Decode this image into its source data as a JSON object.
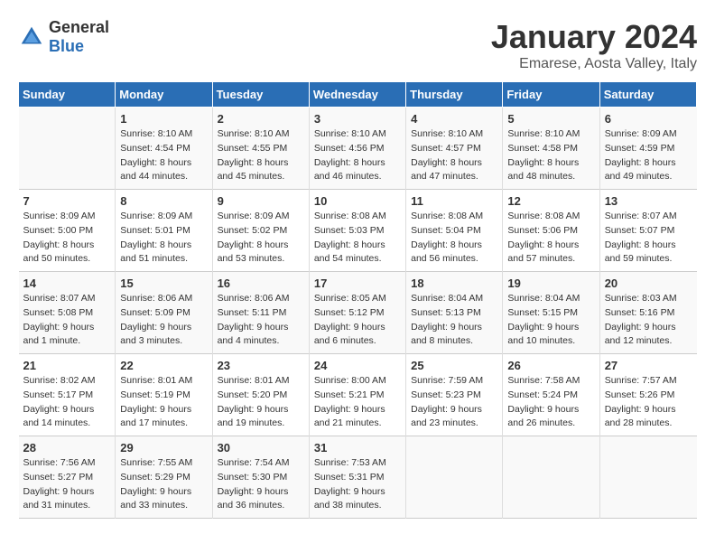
{
  "logo": {
    "general": "General",
    "blue": "Blue"
  },
  "header": {
    "month": "January 2024",
    "location": "Emarese, Aosta Valley, Italy"
  },
  "weekdays": [
    "Sunday",
    "Monday",
    "Tuesday",
    "Wednesday",
    "Thursday",
    "Friday",
    "Saturday"
  ],
  "weeks": [
    [
      {
        "day": "",
        "sunrise": "",
        "sunset": "",
        "daylight": ""
      },
      {
        "day": "1",
        "sunrise": "Sunrise: 8:10 AM",
        "sunset": "Sunset: 4:54 PM",
        "daylight": "Daylight: 8 hours and 44 minutes."
      },
      {
        "day": "2",
        "sunrise": "Sunrise: 8:10 AM",
        "sunset": "Sunset: 4:55 PM",
        "daylight": "Daylight: 8 hours and 45 minutes."
      },
      {
        "day": "3",
        "sunrise": "Sunrise: 8:10 AM",
        "sunset": "Sunset: 4:56 PM",
        "daylight": "Daylight: 8 hours and 46 minutes."
      },
      {
        "day": "4",
        "sunrise": "Sunrise: 8:10 AM",
        "sunset": "Sunset: 4:57 PM",
        "daylight": "Daylight: 8 hours and 47 minutes."
      },
      {
        "day": "5",
        "sunrise": "Sunrise: 8:10 AM",
        "sunset": "Sunset: 4:58 PM",
        "daylight": "Daylight: 8 hours and 48 minutes."
      },
      {
        "day": "6",
        "sunrise": "Sunrise: 8:09 AM",
        "sunset": "Sunset: 4:59 PM",
        "daylight": "Daylight: 8 hours and 49 minutes."
      }
    ],
    [
      {
        "day": "7",
        "sunrise": "Sunrise: 8:09 AM",
        "sunset": "Sunset: 5:00 PM",
        "daylight": "Daylight: 8 hours and 50 minutes."
      },
      {
        "day": "8",
        "sunrise": "Sunrise: 8:09 AM",
        "sunset": "Sunset: 5:01 PM",
        "daylight": "Daylight: 8 hours and 51 minutes."
      },
      {
        "day": "9",
        "sunrise": "Sunrise: 8:09 AM",
        "sunset": "Sunset: 5:02 PM",
        "daylight": "Daylight: 8 hours and 53 minutes."
      },
      {
        "day": "10",
        "sunrise": "Sunrise: 8:08 AM",
        "sunset": "Sunset: 5:03 PM",
        "daylight": "Daylight: 8 hours and 54 minutes."
      },
      {
        "day": "11",
        "sunrise": "Sunrise: 8:08 AM",
        "sunset": "Sunset: 5:04 PM",
        "daylight": "Daylight: 8 hours and 56 minutes."
      },
      {
        "day": "12",
        "sunrise": "Sunrise: 8:08 AM",
        "sunset": "Sunset: 5:06 PM",
        "daylight": "Daylight: 8 hours and 57 minutes."
      },
      {
        "day": "13",
        "sunrise": "Sunrise: 8:07 AM",
        "sunset": "Sunset: 5:07 PM",
        "daylight": "Daylight: 8 hours and 59 minutes."
      }
    ],
    [
      {
        "day": "14",
        "sunrise": "Sunrise: 8:07 AM",
        "sunset": "Sunset: 5:08 PM",
        "daylight": "Daylight: 9 hours and 1 minute."
      },
      {
        "day": "15",
        "sunrise": "Sunrise: 8:06 AM",
        "sunset": "Sunset: 5:09 PM",
        "daylight": "Daylight: 9 hours and 3 minutes."
      },
      {
        "day": "16",
        "sunrise": "Sunrise: 8:06 AM",
        "sunset": "Sunset: 5:11 PM",
        "daylight": "Daylight: 9 hours and 4 minutes."
      },
      {
        "day": "17",
        "sunrise": "Sunrise: 8:05 AM",
        "sunset": "Sunset: 5:12 PM",
        "daylight": "Daylight: 9 hours and 6 minutes."
      },
      {
        "day": "18",
        "sunrise": "Sunrise: 8:04 AM",
        "sunset": "Sunset: 5:13 PM",
        "daylight": "Daylight: 9 hours and 8 minutes."
      },
      {
        "day": "19",
        "sunrise": "Sunrise: 8:04 AM",
        "sunset": "Sunset: 5:15 PM",
        "daylight": "Daylight: 9 hours and 10 minutes."
      },
      {
        "day": "20",
        "sunrise": "Sunrise: 8:03 AM",
        "sunset": "Sunset: 5:16 PM",
        "daylight": "Daylight: 9 hours and 12 minutes."
      }
    ],
    [
      {
        "day": "21",
        "sunrise": "Sunrise: 8:02 AM",
        "sunset": "Sunset: 5:17 PM",
        "daylight": "Daylight: 9 hours and 14 minutes."
      },
      {
        "day": "22",
        "sunrise": "Sunrise: 8:01 AM",
        "sunset": "Sunset: 5:19 PM",
        "daylight": "Daylight: 9 hours and 17 minutes."
      },
      {
        "day": "23",
        "sunrise": "Sunrise: 8:01 AM",
        "sunset": "Sunset: 5:20 PM",
        "daylight": "Daylight: 9 hours and 19 minutes."
      },
      {
        "day": "24",
        "sunrise": "Sunrise: 8:00 AM",
        "sunset": "Sunset: 5:21 PM",
        "daylight": "Daylight: 9 hours and 21 minutes."
      },
      {
        "day": "25",
        "sunrise": "Sunrise: 7:59 AM",
        "sunset": "Sunset: 5:23 PM",
        "daylight": "Daylight: 9 hours and 23 minutes."
      },
      {
        "day": "26",
        "sunrise": "Sunrise: 7:58 AM",
        "sunset": "Sunset: 5:24 PM",
        "daylight": "Daylight: 9 hours and 26 minutes."
      },
      {
        "day": "27",
        "sunrise": "Sunrise: 7:57 AM",
        "sunset": "Sunset: 5:26 PM",
        "daylight": "Daylight: 9 hours and 28 minutes."
      }
    ],
    [
      {
        "day": "28",
        "sunrise": "Sunrise: 7:56 AM",
        "sunset": "Sunset: 5:27 PM",
        "daylight": "Daylight: 9 hours and 31 minutes."
      },
      {
        "day": "29",
        "sunrise": "Sunrise: 7:55 AM",
        "sunset": "Sunset: 5:29 PM",
        "daylight": "Daylight: 9 hours and 33 minutes."
      },
      {
        "day": "30",
        "sunrise": "Sunrise: 7:54 AM",
        "sunset": "Sunset: 5:30 PM",
        "daylight": "Daylight: 9 hours and 36 minutes."
      },
      {
        "day": "31",
        "sunrise": "Sunrise: 7:53 AM",
        "sunset": "Sunset: 5:31 PM",
        "daylight": "Daylight: 9 hours and 38 minutes."
      },
      {
        "day": "",
        "sunrise": "",
        "sunset": "",
        "daylight": ""
      },
      {
        "day": "",
        "sunrise": "",
        "sunset": "",
        "daylight": ""
      },
      {
        "day": "",
        "sunrise": "",
        "sunset": "",
        "daylight": ""
      }
    ]
  ]
}
